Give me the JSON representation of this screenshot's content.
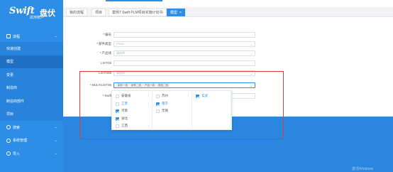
{
  "brand": {
    "logo_text": "Swift",
    "logo_cn": "盘伏",
    "subtitle": "試用账户"
  },
  "sidebar": {
    "items": [
      {
        "label": "流程",
        "type": "group",
        "arrow": "⌄"
      },
      {
        "label": "快速创建",
        "type": "sub"
      },
      {
        "label": "模型",
        "type": "sub",
        "active": true
      },
      {
        "label": "变更",
        "type": "sub"
      },
      {
        "label": "制造商",
        "type": "sub"
      },
      {
        "label": "制造商部件",
        "type": "sub"
      },
      {
        "label": "项目",
        "type": "sub"
      },
      {
        "label": "搜索",
        "type": "group",
        "arrow": "⌄"
      },
      {
        "label": "系统管理",
        "type": "group",
        "arrow": "⌄"
      },
      {
        "label": "导入",
        "type": "group",
        "arrow": "⌄"
      }
    ]
  },
  "tabs": [
    {
      "label": "我的流程"
    },
    {
      "label": "项目"
    },
    {
      "label": "案例7 Swift PLM项目实施计划书"
    },
    {
      "label": "模型",
      "active": true,
      "close": "×"
    }
  ],
  "form": {
    "fields": [
      {
        "label": "编号",
        "required": true,
        "value": ""
      },
      {
        "label": "部件类型",
        "required": true,
        "value": "FRAG"
      },
      {
        "label": "产品线",
        "required": true,
        "value": "请选择"
      },
      {
        "label": "LISTOil",
        "required": false,
        "value": ""
      },
      {
        "label": "LISTO09",
        "required": false,
        "value": "请选择"
      },
      {
        "label": "MULTILIST06",
        "required": true,
        "tags": [
          "制作一线",
          "制作二线",
          "产品一线",
          "质检二线"
        ]
      },
      {
        "label": "Swift",
        "required": true,
        "value": ""
      }
    ]
  },
  "cascader": {
    "columns": [
      [
        {
          "label": "安徽省",
          "checked": false,
          "chevron": "›"
        },
        {
          "label": "江苏",
          "checked": false,
          "chevron": "›",
          "selected": true
        },
        {
          "label": "河南",
          "checked": true
        },
        {
          "label": "湖北",
          "checked": true
        },
        {
          "label": "江西",
          "checked": false,
          "chevron": "›"
        }
      ],
      [
        {
          "label": "苏州",
          "checked": false,
          "chevron": "›"
        },
        {
          "label": "南京",
          "checked": true,
          "selected": true
        },
        {
          "label": "无锡",
          "checked": false
        }
      ],
      [
        {
          "label": "玄武",
          "checked": true,
          "selected": true
        }
      ]
    ]
  },
  "watermark": "激活Windows",
  "colors": {
    "primary": "#2d8ee8",
    "highlight": "#e53935"
  }
}
